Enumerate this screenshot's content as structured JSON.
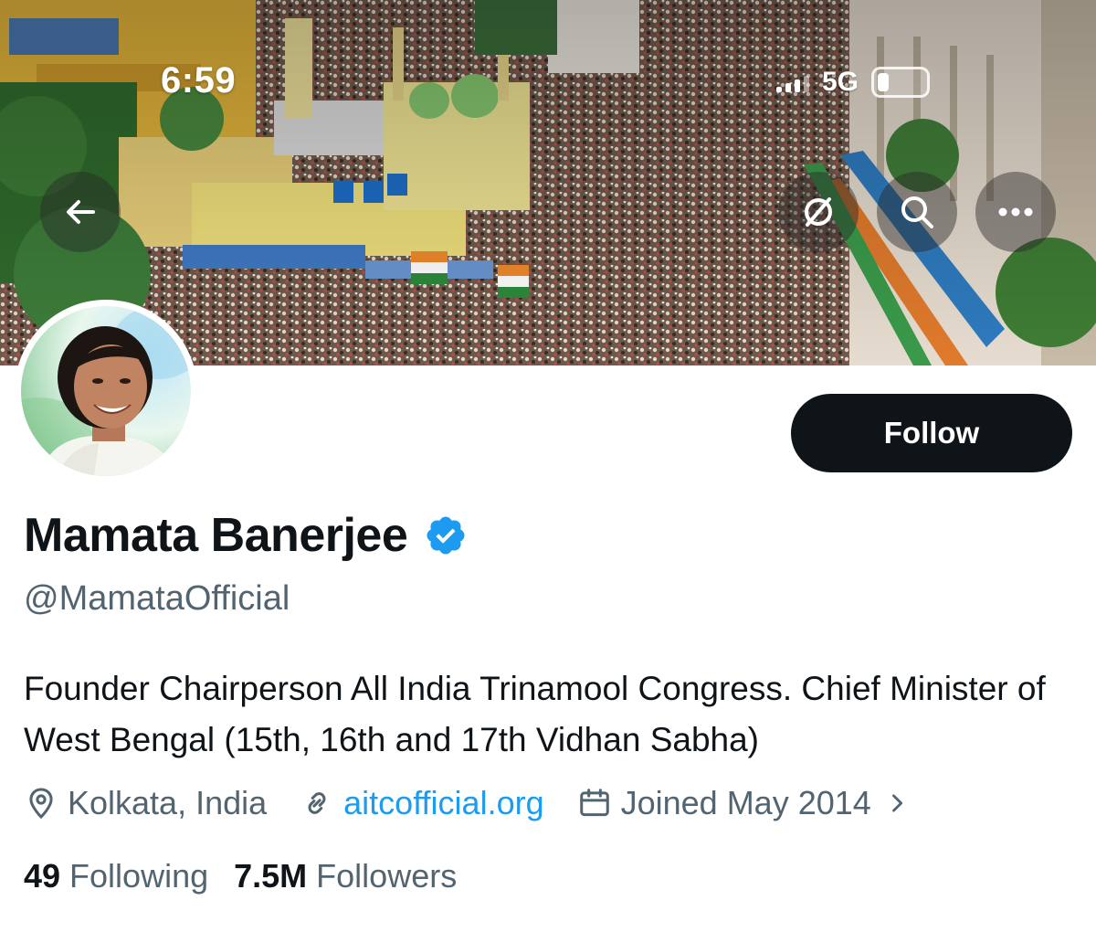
{
  "status_bar": {
    "time": "6:59",
    "network": "5G"
  },
  "header": {
    "back_icon": "arrow-left-icon",
    "actions": [
      "grok-icon",
      "search-icon",
      "more-icon"
    ]
  },
  "profile": {
    "name": "Mamata Banerjee",
    "verified": true,
    "handle": "@MamataOfficial",
    "follow_label": "Follow",
    "bio": "Founder Chairperson All India Trinamool Congress. Chief Minister of West Bengal (15th, 16th and 17th Vidhan Sabha)",
    "location": "Kolkata, India",
    "website": "aitcofficial.org",
    "joined": "Joined May 2014",
    "following_count": "49",
    "following_label": "Following",
    "followers_count": "7.5M",
    "followers_label": "Followers"
  },
  "colors": {
    "accent": "#1d9bf0",
    "text": "#0f1419",
    "secondary": "#536471",
    "button_bg": "#0f1419"
  }
}
